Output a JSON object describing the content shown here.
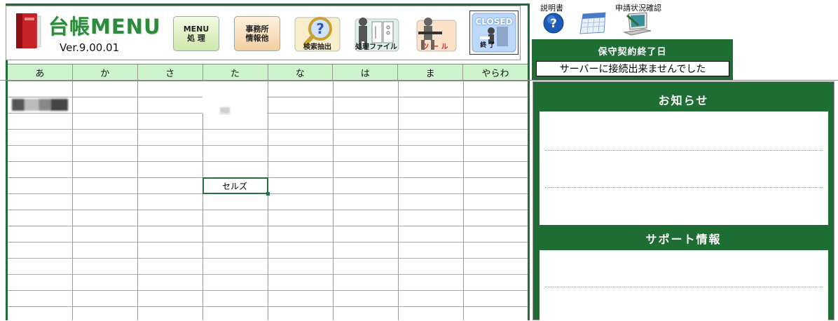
{
  "toolbar": {
    "title": "台帳MENU",
    "version": "Ver.9.00.01",
    "menu_btn_line1": "MENU",
    "menu_btn_line2": "処 理",
    "office_btn_line1": "事務所",
    "office_btn_line2": "情報他",
    "search_btn": "検索抽出",
    "files_btn": "処理ファイル",
    "tools_btn": "ツ ー ル",
    "closed_btn_top": "CLOSED",
    "closed_btn_bottom": "終 了"
  },
  "tabs": [
    "あ",
    "か",
    "さ",
    "た",
    "な",
    "は",
    "ま",
    "やらわ"
  ],
  "grid": {
    "selected_cell_value": "セルズ"
  },
  "top_icons": {
    "help_label": "説明書",
    "status_label": "申請状況確認"
  },
  "maintenance": {
    "title": "保守契約終了日",
    "value": "サーバーに接続出来ませんでした"
  },
  "panels": {
    "notice_title": "お知らせ",
    "support_title": "サポート情報"
  },
  "colors": {
    "brand_green": "#1e6e34",
    "tab_green": "#cdf3cc"
  }
}
